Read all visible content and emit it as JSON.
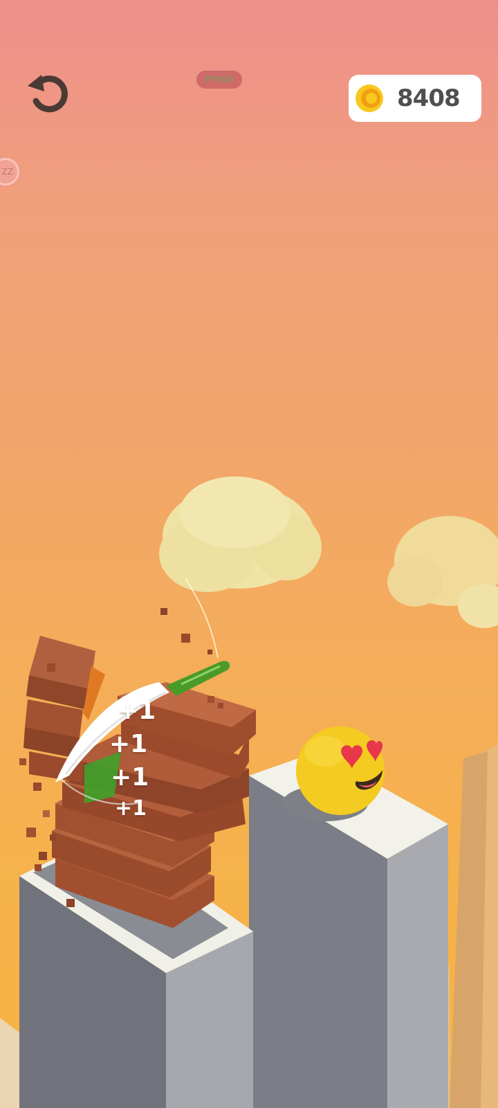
{
  "hud": {
    "restart_icon": "restart-arrow-icon",
    "fps_label": "FPS60",
    "side_bubble_label": "ZZ",
    "coin_icon": "gold-coin-icon",
    "coin_count": "8408"
  },
  "score_popups": [
    "+1",
    "+1",
    "+1",
    "+1"
  ],
  "colors": {
    "sky_top": "#EE8F8C",
    "sky_bottom": "#F7B343",
    "brick": "#B4603D",
    "pillar": "#8D8F96",
    "pillar_top": "#F2F1EA",
    "emoji_ball": "#F4CB20",
    "knife_handle": "#4A9A27"
  }
}
